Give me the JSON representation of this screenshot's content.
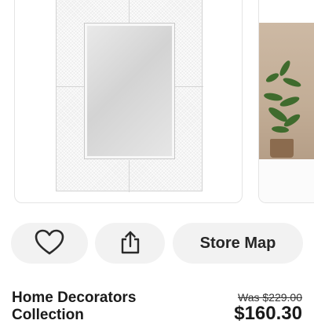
{
  "gallery": {
    "main_image_icon": "mirror-product-image",
    "peek_image_icon": "plant-lifestyle-image"
  },
  "actions": {
    "favorite_icon": "heart-icon",
    "share_icon": "share-icon",
    "store_map_label": "Store Map"
  },
  "product": {
    "brand_line1": "Home Decorators",
    "brand_line2": "Collection",
    "was_price": "Was $229.00",
    "price": "$160.30"
  },
  "colors": {
    "button_bg": "#f2f2f2",
    "text": "#1a1a1a"
  }
}
